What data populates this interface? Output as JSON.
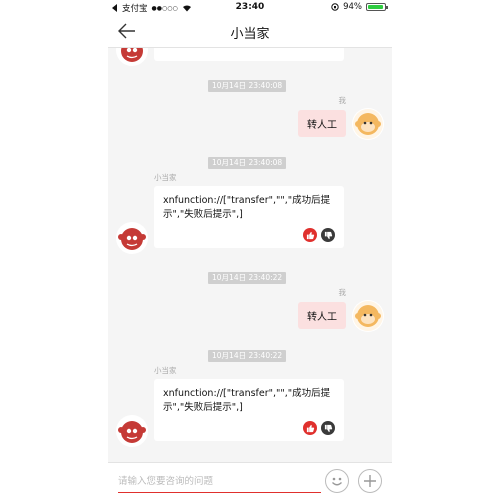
{
  "status": {
    "carrier": "支付宝",
    "signal": "●●○○○",
    "time": "23:40",
    "battery": "94%",
    "battery_level": 0.94
  },
  "nav": {
    "title": "小当家"
  },
  "chat": {
    "messages": [
      {
        "timestamp": "10月14日 23:40:08",
        "sender": "我",
        "text": "转人工"
      },
      {
        "timestamp": "10月14日 23:40:08",
        "sender": "小当家",
        "text": "xnfunction://[\"transfer\",\"\",\"成功后提示\",\"失败后提示\",]"
      },
      {
        "timestamp": "10月14日 23:40:22",
        "sender": "我",
        "text": "转人工"
      },
      {
        "timestamp": "10月14日 23:40:22",
        "sender": "小当家",
        "text": "xnfunction://[\"transfer\",\"\",\"成功后提示\",\"失败后提示\",]"
      }
    ]
  },
  "input": {
    "placeholder": "请输入您要咨询的问题"
  },
  "colors": {
    "accent": "#e0302d",
    "outgoing_bubble": "#fbe0e0",
    "timestamp_bg": "#cfcfcf"
  }
}
